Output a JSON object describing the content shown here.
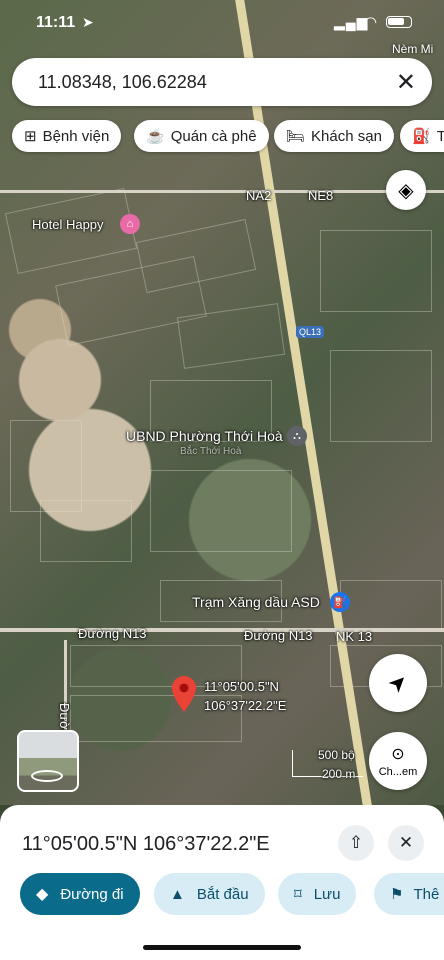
{
  "status": {
    "time": "11:11",
    "carrier_hint": "Nèm Mi"
  },
  "search": {
    "query": "11.08348, 106.62284",
    "clear_icon": "close-icon"
  },
  "chips": [
    {
      "label": "Bệnh viện",
      "icon": "hospital-icon"
    },
    {
      "label": "Quán cà phê",
      "icon": "coffee-icon"
    },
    {
      "label": "Khách sạn",
      "icon": "bed-icon"
    },
    {
      "label": "Tr",
      "icon": "fuel-icon"
    }
  ],
  "map": {
    "roads": {
      "na2": "NA2",
      "ne8": "NE8",
      "ql13": "QL13",
      "n13_left": "Đường N13",
      "n13_right": "Đường N13",
      "nk13": "NK 13",
      "duong_d": "Đường D"
    },
    "places": {
      "hotel": "Hotel Happy",
      "ubnd": "UBND Phường Thới Hoà",
      "gas": "Trạm Xăng dầu ASD",
      "faded": "Bắc Thới Hoà"
    },
    "pin": {
      "lat": "11°05'00.5\"N",
      "lng": "106°37'22.2\"E"
    },
    "scale": {
      "imperial": "500 bộ",
      "metric": "200 m"
    },
    "chem_label": "Ch...em",
    "colors": {
      "pin": "#ea4335",
      "gas": "#1a73e8",
      "hotel": "#e86ba8",
      "ubnd": "#5f6368"
    }
  },
  "sheet": {
    "title": "11°05'00.5\"N 106°37'22.2\"E",
    "actions": {
      "directions": "Đường đi",
      "start": "Bắt đầu",
      "save": "Lưu",
      "more": "Thê"
    }
  }
}
